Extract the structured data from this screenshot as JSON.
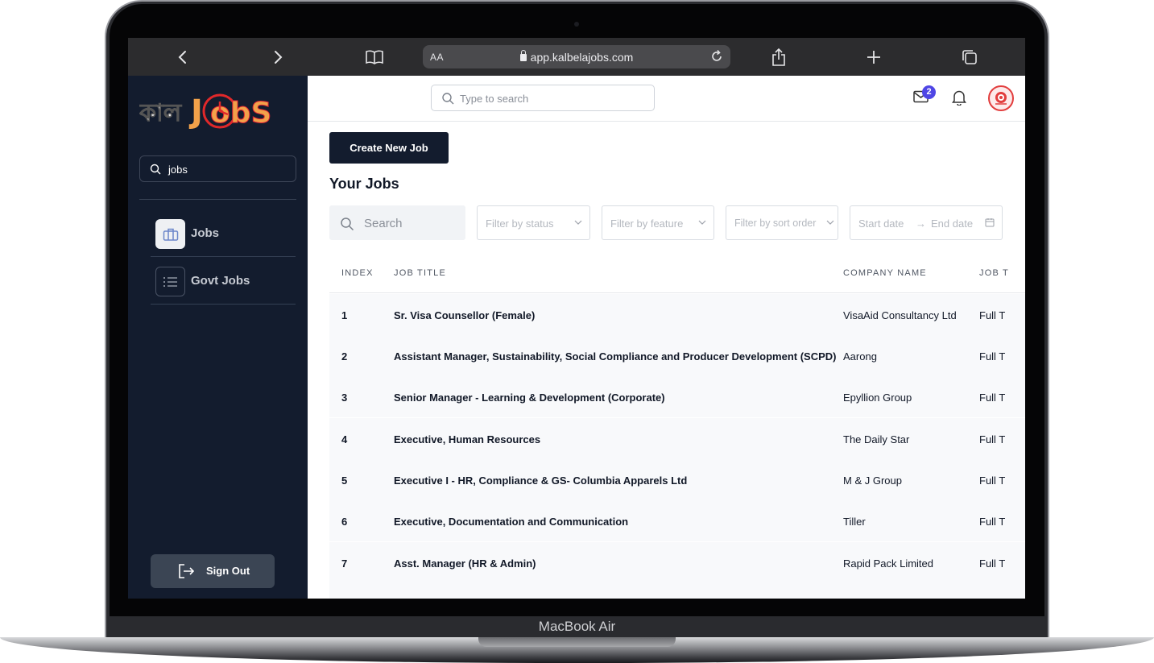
{
  "device": {
    "model_label": "MacBook Air"
  },
  "browser": {
    "url": "app.kalbelajobs.com",
    "text_size_label": "AA",
    "back_icon": "chevron-left-icon",
    "forward_icon": "chevron-right-icon",
    "bookmarks_icon": "book-icon",
    "reload_icon": "reload-icon",
    "share_icon": "share-icon",
    "new_tab_icon": "plus-icon",
    "tabs_icon": "tabs-icon"
  },
  "sidebar": {
    "logo_alt": "কালবেলা Jobs",
    "search_value": "jobs",
    "items": [
      {
        "label": "Jobs",
        "icon": "briefcase-icon",
        "active": true
      },
      {
        "label": "Govt Jobs",
        "icon": "list-icon",
        "active": false
      }
    ],
    "sign_out_label": "Sign Out"
  },
  "topbar": {
    "search_placeholder": "Type to search",
    "mail_badge": "2"
  },
  "main": {
    "create_button": "Create New Job",
    "section_title": "Your Jobs",
    "filters": {
      "search_placeholder": "Search",
      "status_placeholder": "Filter by status",
      "feature_placeholder": "Filter by feature",
      "sort_placeholder": "Filter by sort order",
      "start_date_placeholder": "Start date",
      "end_date_placeholder": "End date"
    },
    "table": {
      "columns": [
        "INDEX",
        "JOB TITLE",
        "COMPANY NAME",
        "JOB T"
      ],
      "rows": [
        {
          "index": "1",
          "title": "Sr. Visa Counsellor (Female)",
          "company": "VisaAid Consultancy Ltd",
          "type": "Full T"
        },
        {
          "index": "2",
          "title": "Assistant Manager, Sustainability, Social Compliance and Producer Development (SCPD)",
          "company": "Aarong",
          "type": "Full T"
        },
        {
          "index": "3",
          "title": "Senior Manager - Learning & Development (Corporate)",
          "company": "Epyllion Group",
          "type": "Full T"
        },
        {
          "index": "4",
          "title": "Executive, Human Resources",
          "company": "The Daily Star",
          "type": "Full T"
        },
        {
          "index": "5",
          "title": "Executive I - HR, Compliance & GS- Columbia Apparels Ltd",
          "company": "M & J Group",
          "type": "Full T"
        },
        {
          "index": "6",
          "title": "Executive, Documentation and Communication",
          "company": "Tiller",
          "type": "Full T"
        },
        {
          "index": "7",
          "title": "Asst. Manager (HR & Admin)",
          "company": "Rapid Pack Limited",
          "type": "Full T"
        }
      ]
    }
  }
}
